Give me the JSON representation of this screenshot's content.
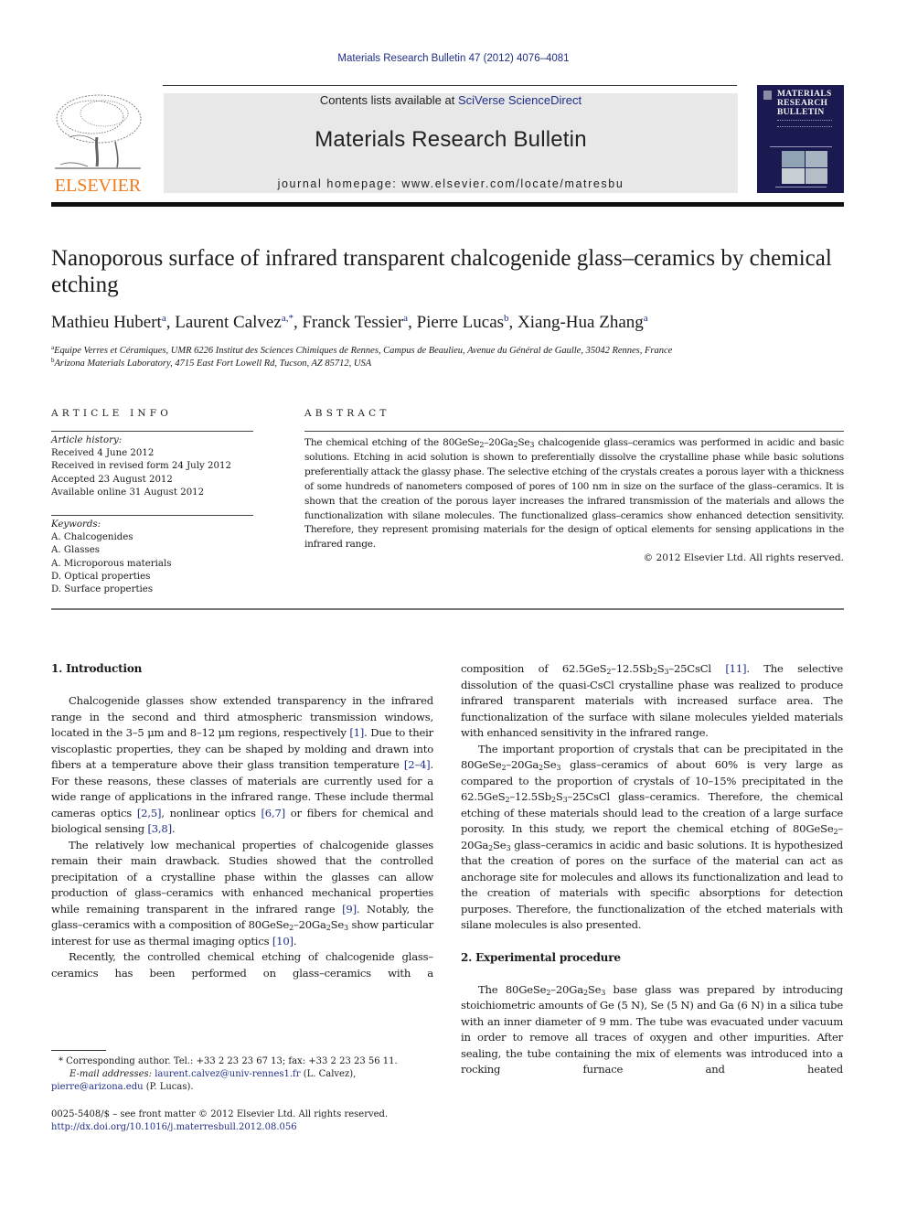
{
  "header": {
    "citation": "Materials Research Bulletin 47 (2012) 4076–4081",
    "publisher_logo_text": "ELSEVIER",
    "contents_prefix": "Contents lists available at ",
    "contents_link": "SciVerse ScienceDirect",
    "journal_name": "Materials Research Bulletin",
    "homepage": "journal homepage: www.elsevier.com/locate/matresbu",
    "cover_title": [
      "MATERIALS",
      "RESEARCH",
      "BULLETIN"
    ]
  },
  "colors": {
    "link": "#1f2f86",
    "elsevier_orange": "#f07a1a",
    "cover_bg": "#1a1950",
    "banner_bg": "#e8e8e8"
  },
  "article": {
    "title": "Nanoporous surface of infrared transparent chalcogenide glass–ceramics by chemical etching",
    "authors": [
      {
        "name": "Mathieu Hubert",
        "aff": "a"
      },
      {
        "name": "Laurent Calvez",
        "aff": "a,*"
      },
      {
        "name": "Franck Tessier",
        "aff": "a"
      },
      {
        "name": "Pierre Lucas",
        "aff": "b"
      },
      {
        "name": "Xiang-Hua Zhang",
        "aff": "a"
      }
    ],
    "affiliations": [
      {
        "mark": "a",
        "text": "Equipe Verres et Céramiques, UMR 6226 Institut des Sciences Chimiques de Rennes, Campus de Beaulieu, Avenue du Général de Gaulle, 35042 Rennes, France"
      },
      {
        "mark": "b",
        "text": "Arizona Materials Laboratory, 4715 East Fort Lowell Rd, Tucson, AZ 85712, USA"
      }
    ]
  },
  "article_info": {
    "caption": "ARTICLE INFO",
    "history_label": "Article history:",
    "history": [
      "Received 4 June 2012",
      "Received in revised form 24 July 2012",
      "Accepted 23 August 2012",
      "Available online 31 August 2012"
    ],
    "keywords_label": "Keywords:",
    "keywords": [
      "A. Chalcogenides",
      "A. Glasses",
      "A. Microporous materials",
      "D. Optical properties",
      "D. Surface properties"
    ]
  },
  "abstract": {
    "caption": "ABSTRACT",
    "p1_a": "The chemical etching of the 80GeSe",
    "p1_b": "–20Ga",
    "p1_c": "Se",
    "p1_d": " chalcogenide glass–ceramics was performed in acidic and basic solutions. Etching in acid solution is shown to preferentially dissolve the crystalline phase while basic solutions preferentially attack the glassy phase. The selective etching of the crystals creates a porous layer with a thickness of some hundreds of nanometers composed of pores of 100 nm in size on the surface of the glass–ceramics. It is shown that the creation of the porous layer increases the infrared transmission of the materials and allows the functionalization with silane molecules. The functionalized glass–ceramics show enhanced detection sensitivity. Therefore, they represent promising materials for the design of optical elements for sensing applications in the infrared range.",
    "copyright": "© 2012 Elsevier Ltd. All rights reserved."
  },
  "body": {
    "intro_heading": "1.  Introduction",
    "intro_p1": [
      "Chalcogenide glasses show extended transparency in the infrared range in the second and third atmospheric transmission windows, located in the 3–5 μm and 8–12 μm regions, respectively ",
      "[1]",
      ". Due to their viscoplastic properties, they can be shaped by molding and drawn into fibers at a temperature above their glass transition temperature ",
      "[2–4]",
      ". For these reasons, these classes of materials are currently used for a wide range of applications in the infrared range. These include thermal cameras optics ",
      "[2,5]",
      ", nonlinear optics ",
      "[6,7]",
      " or fibers for chemical and biological sensing ",
      "[3,8]",
      "."
    ],
    "intro_p2": [
      "The relatively low mechanical properties of chalcogenide glasses remain their main drawback. Studies showed that the controlled precipitation of a crystalline phase within the glasses can allow production of glass–ceramics with enhanced mechanical properties while remaining transparent in the infrared range ",
      "[9]",
      ". Notably, the glass–ceramics with a composition of 80GeSe",
      "2",
      "–20Ga",
      "2",
      "Se",
      "3",
      " show particular interest for use as thermal imaging optics ",
      "[10]",
      "."
    ],
    "intro_p3": "Recently, the controlled chemical etching of chalcogenide glass–ceramics has been performed on glass–ceramics with a",
    "right_p1": [
      "composition of 62.5GeS",
      "2",
      "–12.5Sb",
      "2",
      "S",
      "3",
      "–25CsCl ",
      "[11]",
      ". The selective dissolution of the quasi-CsCl crystalline phase was realized to produce infrared transparent materials with increased surface area. The functionalization of the surface with silane molecules yielded materials with enhanced sensitivity in the infrared range."
    ],
    "right_p2": [
      "The important proportion of crystals that can be precipitated in the 80GeSe",
      "2",
      "–20Ga",
      "2",
      "Se",
      "3",
      " glass–ceramics of about 60% is very large as compared to the proportion of crystals of 10–15% precipitated in the 62.5GeS",
      "2",
      "–12.5Sb",
      "2",
      "S",
      "3",
      "–25CsCl glass–ceramics. Therefore, the chemical etching of these materials should lead to the creation of a large surface porosity. In this study, we report the chemical etching of 80GeSe",
      "2",
      "–20Ga",
      "2",
      "Se",
      "3",
      " glass–ceramics in acidic and basic solutions. It is hypothesized that the creation of pores on the surface of the material can act as anchorage site for molecules and allows its functionalization and lead to the creation of materials with specific absorptions for detection purposes. Therefore, the functionalization of the etched materials with silane molecules is also presented."
    ],
    "exp_heading": "2.  Experimental procedure",
    "exp_p1": [
      "The 80GeSe",
      "2",
      "–20Ga",
      "2",
      "Se",
      "3",
      " base glass was prepared by introducing stoichiometric amounts of Ge (5 N), Se (5 N) and Ga (6 N) in a silica tube with an inner diameter of 9 mm. The tube was evacuated under vacuum in order to remove all traces of oxygen and other impurities. After sealing, the tube containing the mix of elements was introduced into a rocking furnace and heated"
    ]
  },
  "footnotes": {
    "corresponding": "* Corresponding author. Tel.: +33 2 23 23 67 13; fax: +33 2 23 23 56 11.",
    "email_label": "E-mail addresses:",
    "email1": "laurent.calvez@univ-rennes1.fr",
    "email1_name": " (L. Calvez),",
    "email2": "pierre@arizona.edu",
    "email2_name": " (P. Lucas).",
    "front_matter": "0025-5408/$ – see front matter © 2012 Elsevier Ltd. All rights reserved.",
    "doi": "http://dx.doi.org/10.1016/j.materresbull.2012.08.056"
  }
}
